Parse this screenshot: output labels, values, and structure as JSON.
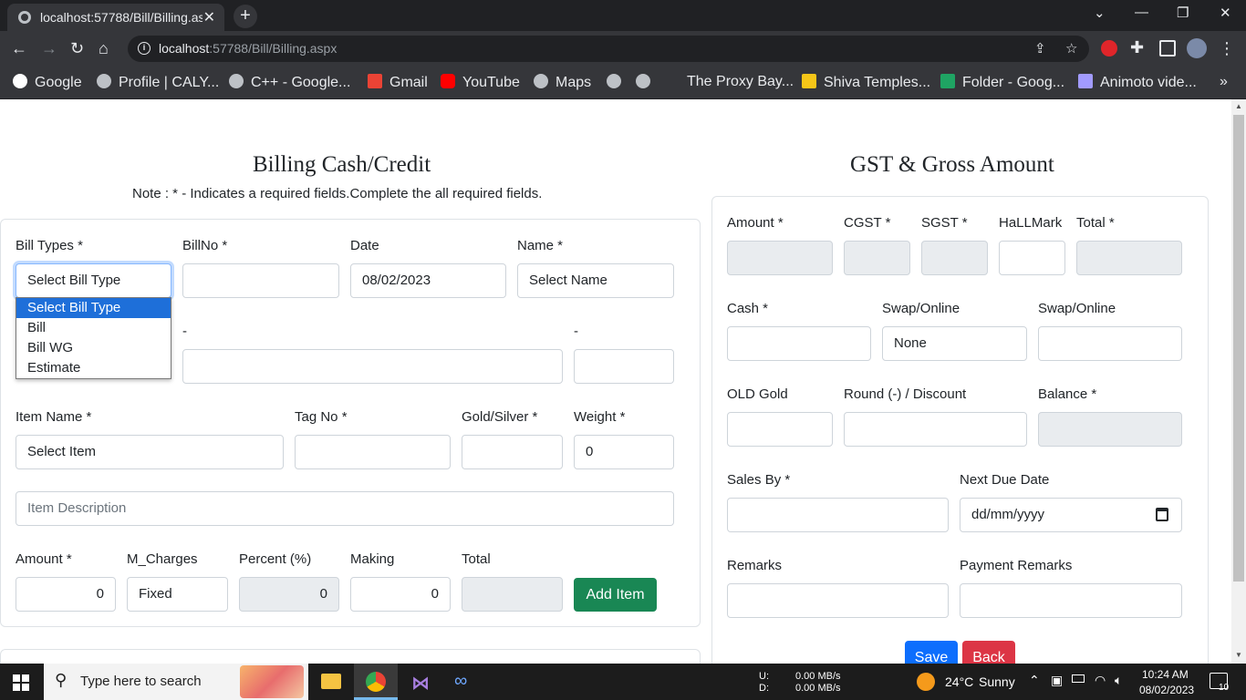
{
  "browser": {
    "tab_title": "localhost:57788/Bill/Billing.aspx",
    "url_host": "localhost",
    "url_path": ":57788/Bill/Billing.aspx",
    "bookmarks": [
      "Google",
      "Profile | CALY...",
      "C++ - Google...",
      "Gmail",
      "YouTube",
      "Maps",
      "The Proxy Bay...",
      "Shiva Temples...",
      "Folder - Goog...",
      "Animoto vide..."
    ]
  },
  "billing": {
    "title": "Billing Cash/Credit",
    "note": "Note : * - Indicates a required fields.Complete the all required fields.",
    "bill_types_label": "Bill Types *",
    "bill_types_value": "Select Bill Type",
    "bill_types_options": [
      "Select Bill Type",
      "Bill",
      "Bill WG",
      "Estimate"
    ],
    "bill_no_label": "BillNo *",
    "bill_no_value": "",
    "date_label": "Date",
    "date_value": "08/02/2023",
    "name_label": "Name *",
    "name_value": "Select Name",
    "row2_label_a": "-",
    "row2_label_b": "-",
    "item_name_label": "Item Name *",
    "item_name_value": "Select Item",
    "tag_no_label": "Tag No *",
    "gold_silver_label": "Gold/Silver *",
    "weight_label": "Weight *",
    "weight_value": "0",
    "item_description_placeholder": "Item Description",
    "amount_label": "Amount *",
    "amount_value": "0",
    "m_charges_label": "M_Charges",
    "m_charges_value": "Fixed",
    "percent_label": "Percent (%)",
    "percent_value": "0",
    "making_label": "Making",
    "making_value": "0",
    "total_label": "Total",
    "add_item_label": "Add Item"
  },
  "gst": {
    "title": "GST & Gross Amount",
    "amount_label": "Amount *",
    "cgst_label": "CGST *",
    "sgst_label": "SGST *",
    "hallmark_label": "HaLLMark",
    "total_label": "Total *",
    "cash_label": "Cash *",
    "swap1_label": "Swap/Online",
    "swap1_value": "None",
    "swap2_label": "Swap/Online",
    "old_gold_label": "OLD Gold",
    "round_discount_label": "Round (-) / Discount",
    "balance_label": "Balance *",
    "sales_by_label": "Sales By *",
    "next_due_date_label": "Next Due Date",
    "next_due_date_value": "dd/mm/yyyy",
    "remarks_label": "Remarks",
    "payment_remarks_label": "Payment Remarks",
    "save_label": "Save",
    "back_label": "Back"
  },
  "taskbar": {
    "search_placeholder": "Type here to search",
    "net_up_label": "U:",
    "net_up_value": "0.00 MB/s",
    "net_down_label": "D:",
    "net_down_value": "0.00 MB/s",
    "weather_temp": "24°C",
    "weather_desc": "Sunny",
    "time": "10:24 AM",
    "date": "08/02/2023",
    "notification_count": "10"
  },
  "colors": {
    "success": "#198754",
    "primary": "#0d6efd",
    "danger": "#dc3545",
    "disabled_fill": "#e9ecef",
    "chrome_dark": "#35363a"
  }
}
